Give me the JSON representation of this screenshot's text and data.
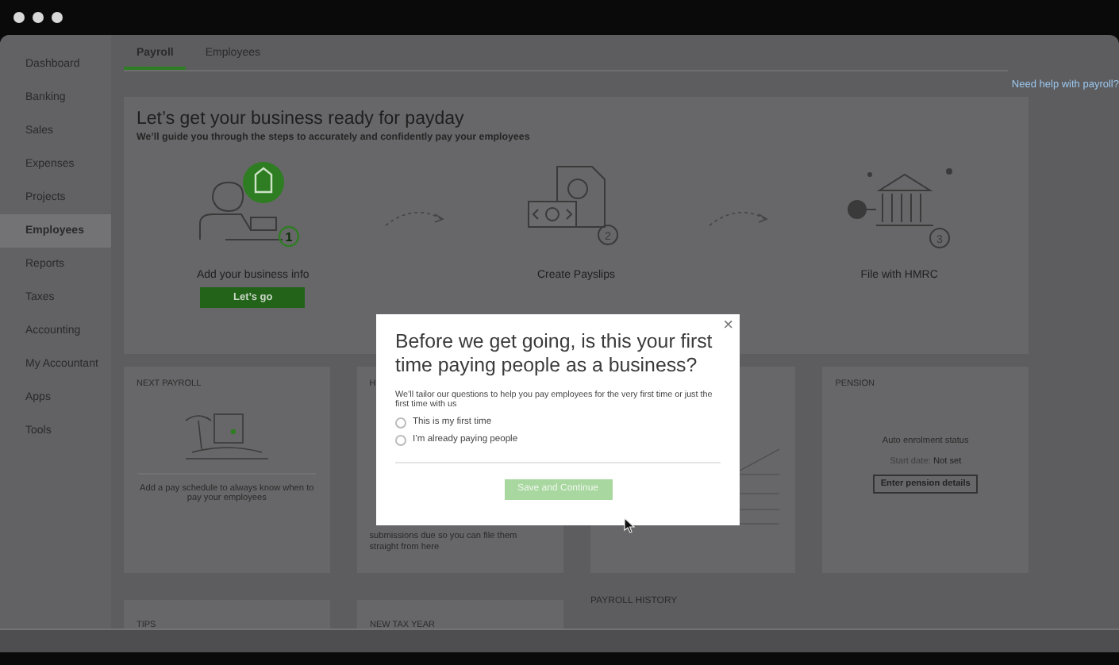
{
  "sidebar": {
    "items": [
      {
        "label": "Dashboard",
        "selected": false
      },
      {
        "label": "Banking",
        "selected": false
      },
      {
        "label": "Sales",
        "selected": false
      },
      {
        "label": "Expenses",
        "selected": false
      },
      {
        "label": "Projects",
        "selected": false
      },
      {
        "label": "Employees",
        "selected": true
      },
      {
        "label": "Reports",
        "selected": false
      },
      {
        "label": "Taxes",
        "selected": false
      },
      {
        "label": "Accounting",
        "selected": false
      },
      {
        "label": "My Accountant",
        "selected": false
      },
      {
        "label": "Apps",
        "selected": false
      },
      {
        "label": "Tools",
        "selected": false
      }
    ]
  },
  "tabs": [
    {
      "label": "Payroll",
      "selected": true
    },
    {
      "label": "Employees",
      "selected": false
    }
  ],
  "help_link": "Need help with payroll?",
  "hero": {
    "title": "Let’s get your business ready for payday",
    "subtitle": "We’ll guide you through the steps to accurately and confidently pay your employees",
    "steps": [
      {
        "kind": "business",
        "number": "1",
        "label": "Add your business info",
        "button": "Let’s go"
      },
      {
        "kind": "payslips",
        "number": "2",
        "label": "Create Payslips"
      },
      {
        "kind": "hmrc",
        "number": "3",
        "label": "File with HMRC"
      }
    ]
  },
  "cards": [
    {
      "kind": "schedule",
      "title": "NEXT PAYROLL",
      "text": "Add a pay schedule to always know when to pay your employees"
    },
    {
      "kind": "submissions",
      "title": "H",
      "lines": [
        "submissions due so you can file them",
        "straight from here"
      ]
    },
    {
      "kind": "chart"
    },
    {
      "kind": "pension",
      "title": "PENSION",
      "status": "Auto enrolment status",
      "start_label": "Start date:",
      "start_value": "Not set",
      "button": "Enter pension details"
    }
  ],
  "lower_cards": [
    {
      "title": "TIPS"
    },
    {
      "title": "NEW TAX YEAR"
    }
  ],
  "payroll_history": "PAYROLL HISTORY",
  "modal": {
    "title": "Before we get going, is this your first time paying people as a business?",
    "text": "We’ll tailor our questions to help you pay employees for the very first time or just the first time with us",
    "options": [
      {
        "label": "This is my first time",
        "selected": false
      },
      {
        "label": "I’m already paying people",
        "selected": false
      }
    ],
    "button": "Save and Continue",
    "close": "×"
  }
}
